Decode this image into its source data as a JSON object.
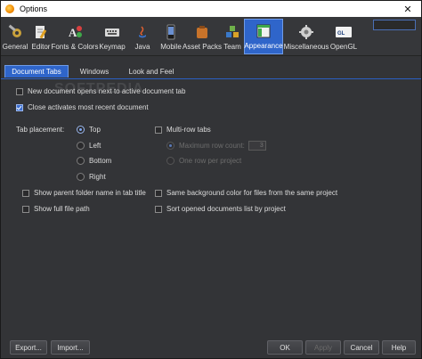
{
  "window": {
    "title": "Options"
  },
  "toolbar": {
    "categories": [
      {
        "label": "General",
        "icon": "wrench-gear-icon",
        "selected": false
      },
      {
        "label": "Editor",
        "icon": "editor-icon",
        "selected": false
      },
      {
        "label": "Fonts & Colors",
        "icon": "fonts-colors-icon",
        "selected": false
      },
      {
        "label": "Keymap",
        "icon": "keyboard-icon",
        "selected": false
      },
      {
        "label": "Java",
        "icon": "java-icon",
        "selected": false
      },
      {
        "label": "Mobile",
        "icon": "mobile-icon",
        "selected": false
      },
      {
        "label": "Asset Packs",
        "icon": "asset-packs-icon",
        "selected": false
      },
      {
        "label": "Team",
        "icon": "team-icon",
        "selected": false
      },
      {
        "label": "Appearance",
        "icon": "appearance-icon",
        "selected": true
      },
      {
        "label": "Miscellaneous",
        "icon": "miscellaneous-icon",
        "selected": false
      },
      {
        "label": "OpenGL",
        "icon": "opengl-icon",
        "selected": false
      }
    ]
  },
  "tabs": [
    {
      "label": "Document Tabs",
      "selected": true
    },
    {
      "label": "Windows",
      "selected": false
    },
    {
      "label": "Look and Feel",
      "selected": false
    }
  ],
  "options": {
    "new_doc_next": {
      "label": "New document opens next to active document tab",
      "checked": false
    },
    "close_activates": {
      "label": "Close activates most recent document",
      "checked": true
    },
    "tab_placement_label": "Tab placement:",
    "placement": [
      {
        "label": "Top",
        "checked": true
      },
      {
        "label": "Left",
        "checked": false
      },
      {
        "label": "Bottom",
        "checked": false
      },
      {
        "label": "Right",
        "checked": false
      }
    ],
    "multi_row": {
      "label": "Multi-row tabs",
      "checked": false
    },
    "max_row_count": {
      "label": "Maximum row count:",
      "value": "3"
    },
    "one_row_per_project": {
      "label": "One row per project"
    },
    "show_parent_folder": {
      "label": "Show parent folder name in tab title",
      "checked": false
    },
    "same_bg_color": {
      "label": "Same background color for files from the same project",
      "checked": false
    },
    "show_full_path": {
      "label": "Show full file path",
      "checked": false
    },
    "sort_by_project": {
      "label": "Sort opened documents list by project",
      "checked": false
    }
  },
  "buttons": {
    "export": "Export...",
    "import": "Import...",
    "ok": "OK",
    "apply": "Apply",
    "cancel": "Cancel",
    "help": "Help"
  },
  "watermark": "SOFTPEDIA",
  "colors": {
    "accent": "#2f65ca",
    "background": "#333437"
  }
}
